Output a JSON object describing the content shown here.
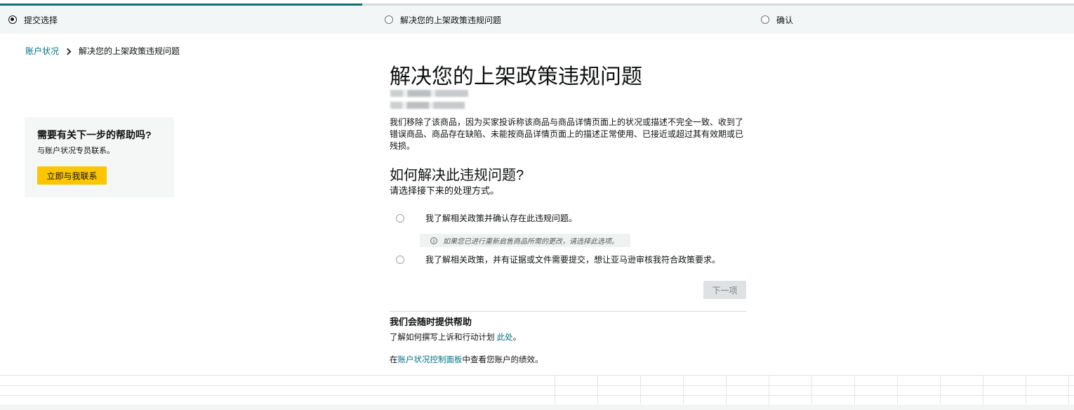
{
  "progress": {
    "completed_fraction": 0.337,
    "steps": [
      {
        "label": "提交选择",
        "selected": true
      },
      {
        "label": "解决您的上架政策违规问题",
        "selected": false
      },
      {
        "label": "确认",
        "selected": false
      }
    ]
  },
  "breadcrumb": {
    "root_link": "账户状况",
    "separator_icon": "chevron-right-icon",
    "current": "解决您的上架政策违规问题"
  },
  "help_box": {
    "title": "需要有关下一步的帮助吗?",
    "subtitle": "与账户状况专员联系。",
    "button_label": "立即与我联系"
  },
  "main": {
    "title": "解决您的上架政策违规问题",
    "description": "我们移除了该商品，因为买家投诉称该商品与商品详情页面上的状况或描述不完全一致、收到了错误商品、商品存在缺陷、未能按商品详情页面上的描述正常使用、已接近或超过其有效期或已残损。",
    "resolve": {
      "heading": "如何解决此违规问题?",
      "instruction": "请选择接下来的处理方式。",
      "options": [
        {
          "label": "我了解相关政策并确认存在此违规问题。",
          "selected": false,
          "note_icon": "info-icon",
          "note": "如果您已进行重新启售商品所需的更改，请选择此选项。"
        },
        {
          "label": "我了解相关政策，并有证据或文件需要提交，想让亚马逊审核我符合政策要求。",
          "selected": false
        }
      ],
      "next_button": {
        "label": "下一项",
        "disabled": true
      }
    },
    "help_section": {
      "title": "我们会随时提供帮助",
      "appeal_text_before": "了解如何撰写上诉和行动计划 ",
      "appeal_link": "此处",
      "appeal_text_after": "。",
      "dashboard_text_before": "在",
      "dashboard_link": "账户状况控制面板",
      "dashboard_text_after": "中查看您账户的绩效。"
    }
  },
  "colors": {
    "text": "#0f1111",
    "secondary_text": "#565959",
    "link": "#007185",
    "progress_fill": "#0d6e7a",
    "progress_track": "#d5dbdb",
    "stepper_background": "#f3f6f6",
    "help_button": "#fbc500",
    "disabled_button": "#dfe2e3"
  }
}
